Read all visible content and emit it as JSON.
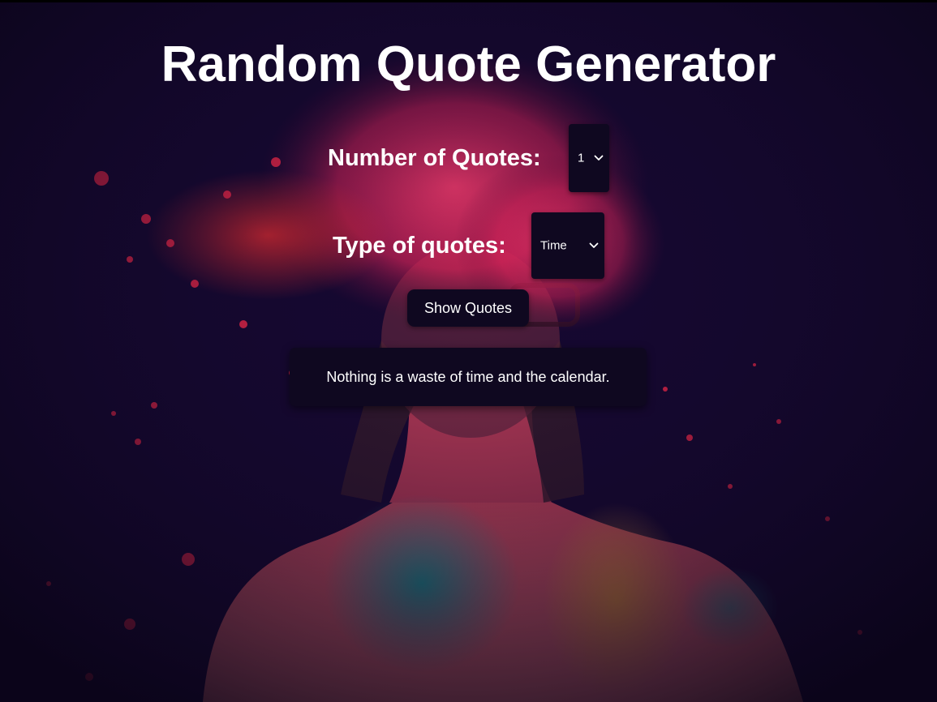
{
  "page": {
    "title": "Random Quote Generator"
  },
  "form": {
    "number_label": "Number of Quotes:",
    "number_value": "1",
    "type_label": "Type of quotes:",
    "type_value": "Time",
    "show_button": "Show Quotes"
  },
  "quotes": [
    "Nothing is a waste of time and the calendar."
  ],
  "colors": {
    "background": "#120628",
    "panel": "#0f0820",
    "text": "#ffffff",
    "accent_paint": "#f02a5a"
  },
  "icons": {
    "select_arrow": "chevron-down-icon"
  }
}
